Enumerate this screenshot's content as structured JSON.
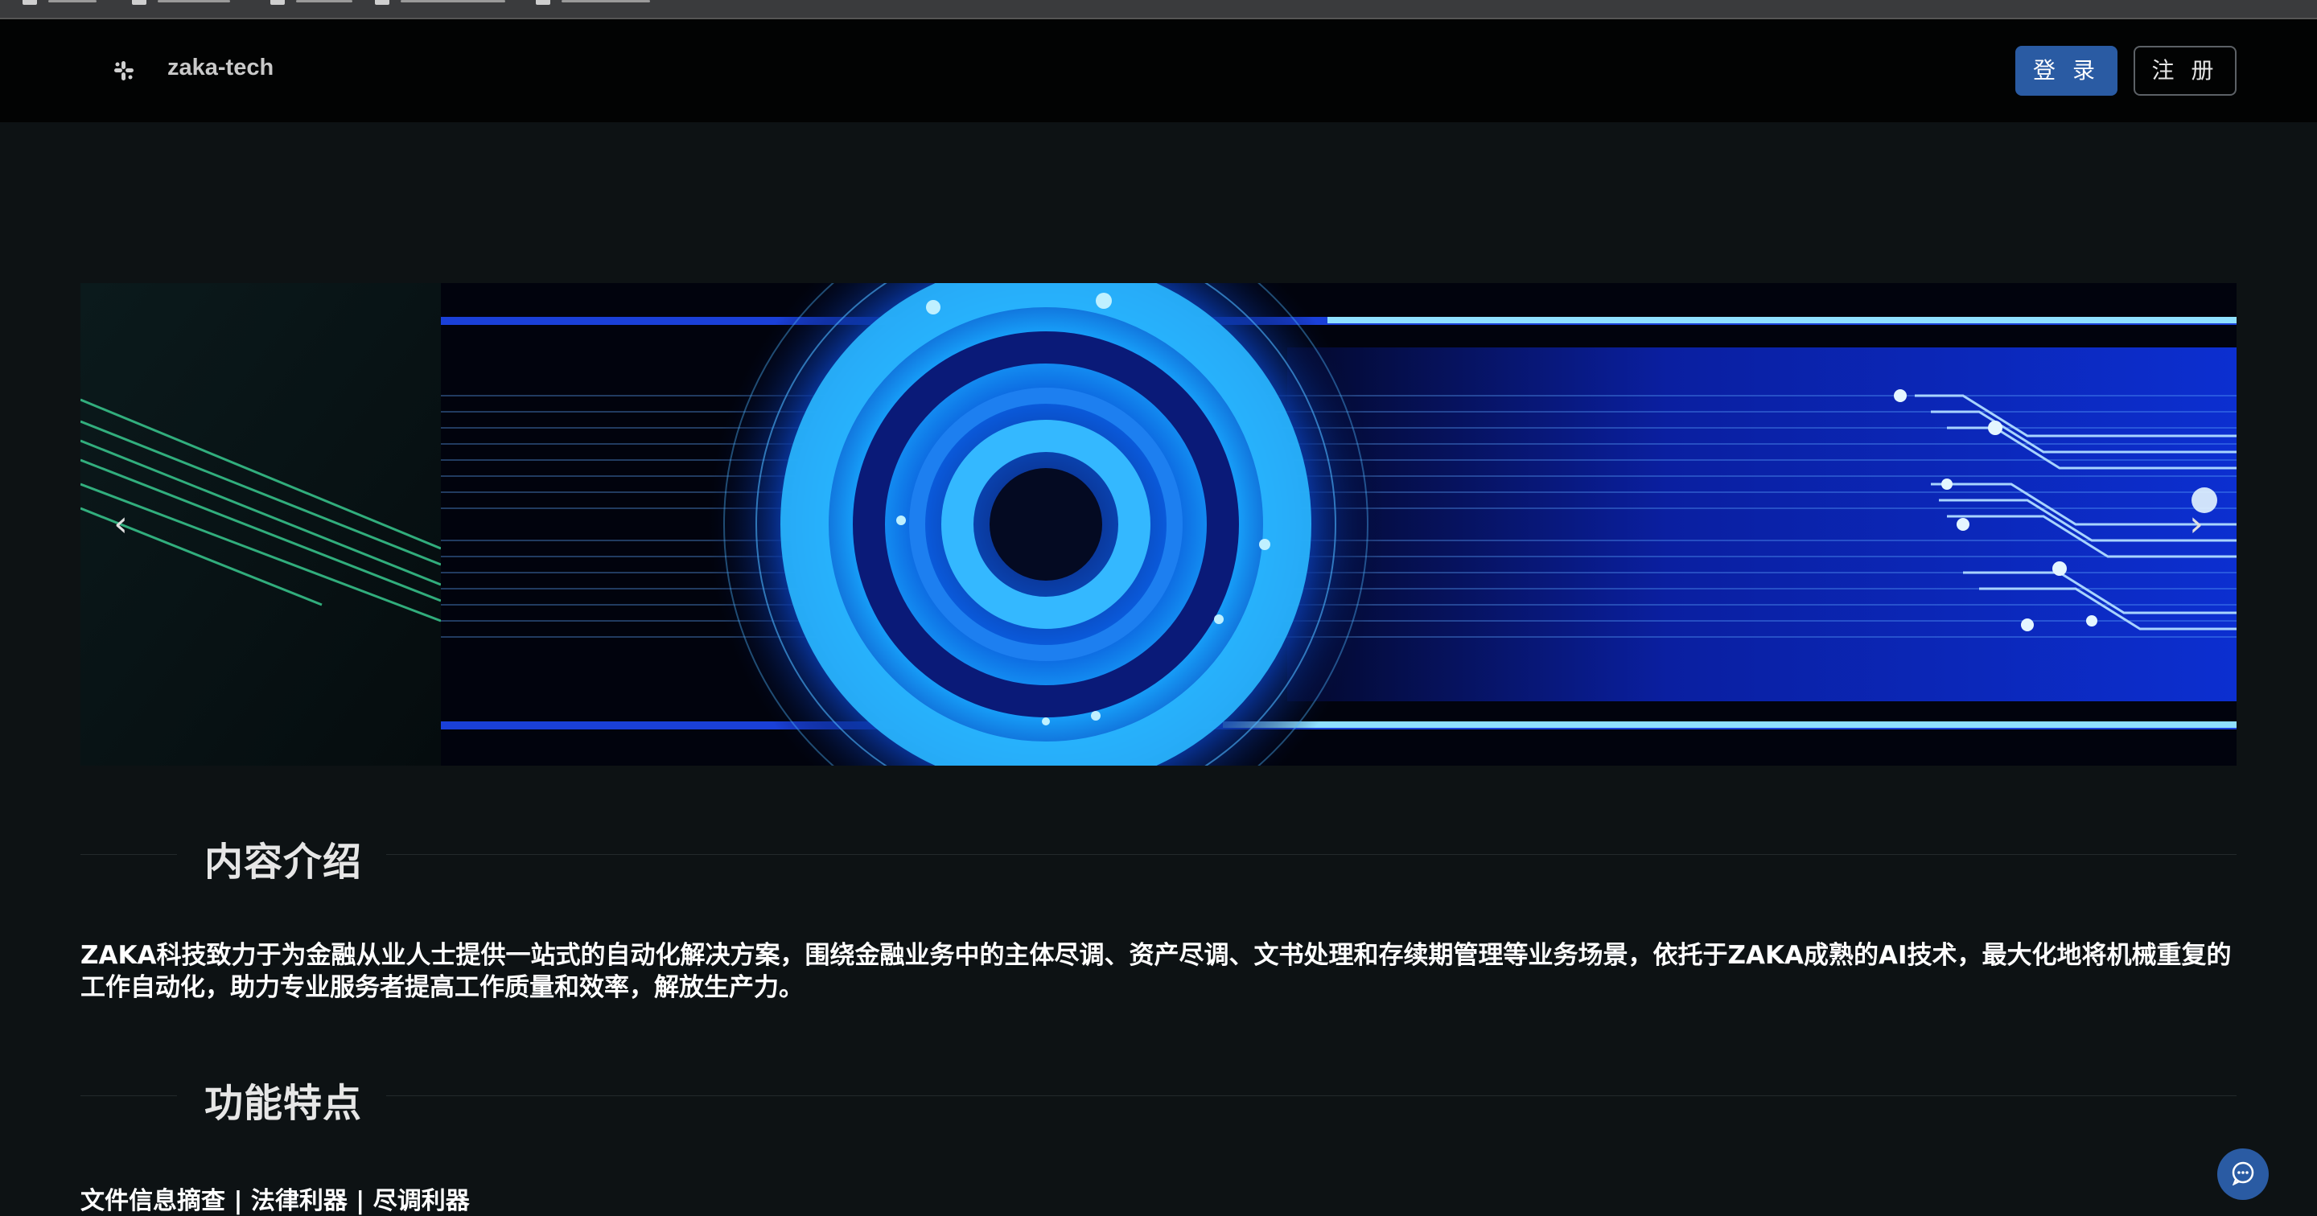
{
  "header": {
    "logo_text": "zaka-tech",
    "login_label": "登 录",
    "register_label": "注 册"
  },
  "banner": {
    "prev_icon": "chevron-left-icon",
    "next_icon": "chevron-right-icon"
  },
  "sections": {
    "intro_title": "内容介绍",
    "intro_text": "ZAKA科技致力于为金融从业人士提供一站式的自动化解决方案，围绕金融业务中的主体尽调、资产尽调、文书处理和存续期管理等业务场景，依托于ZAKA成熟的AI技术，最大化地将机械重复的工作自动化，助力专业服务者提高工作质量和效率，解放生产力。",
    "features_title": "功能特点",
    "features_first_line": "文件信息摘查 | 法律利器 | 尽调利器"
  },
  "colors": {
    "accent": "#2a5ba3",
    "background": "#0d1214",
    "header_bg": "#020303"
  },
  "icons": {
    "logo": "slack-like-logo-icon",
    "chat": "chat-bubble-icon"
  }
}
